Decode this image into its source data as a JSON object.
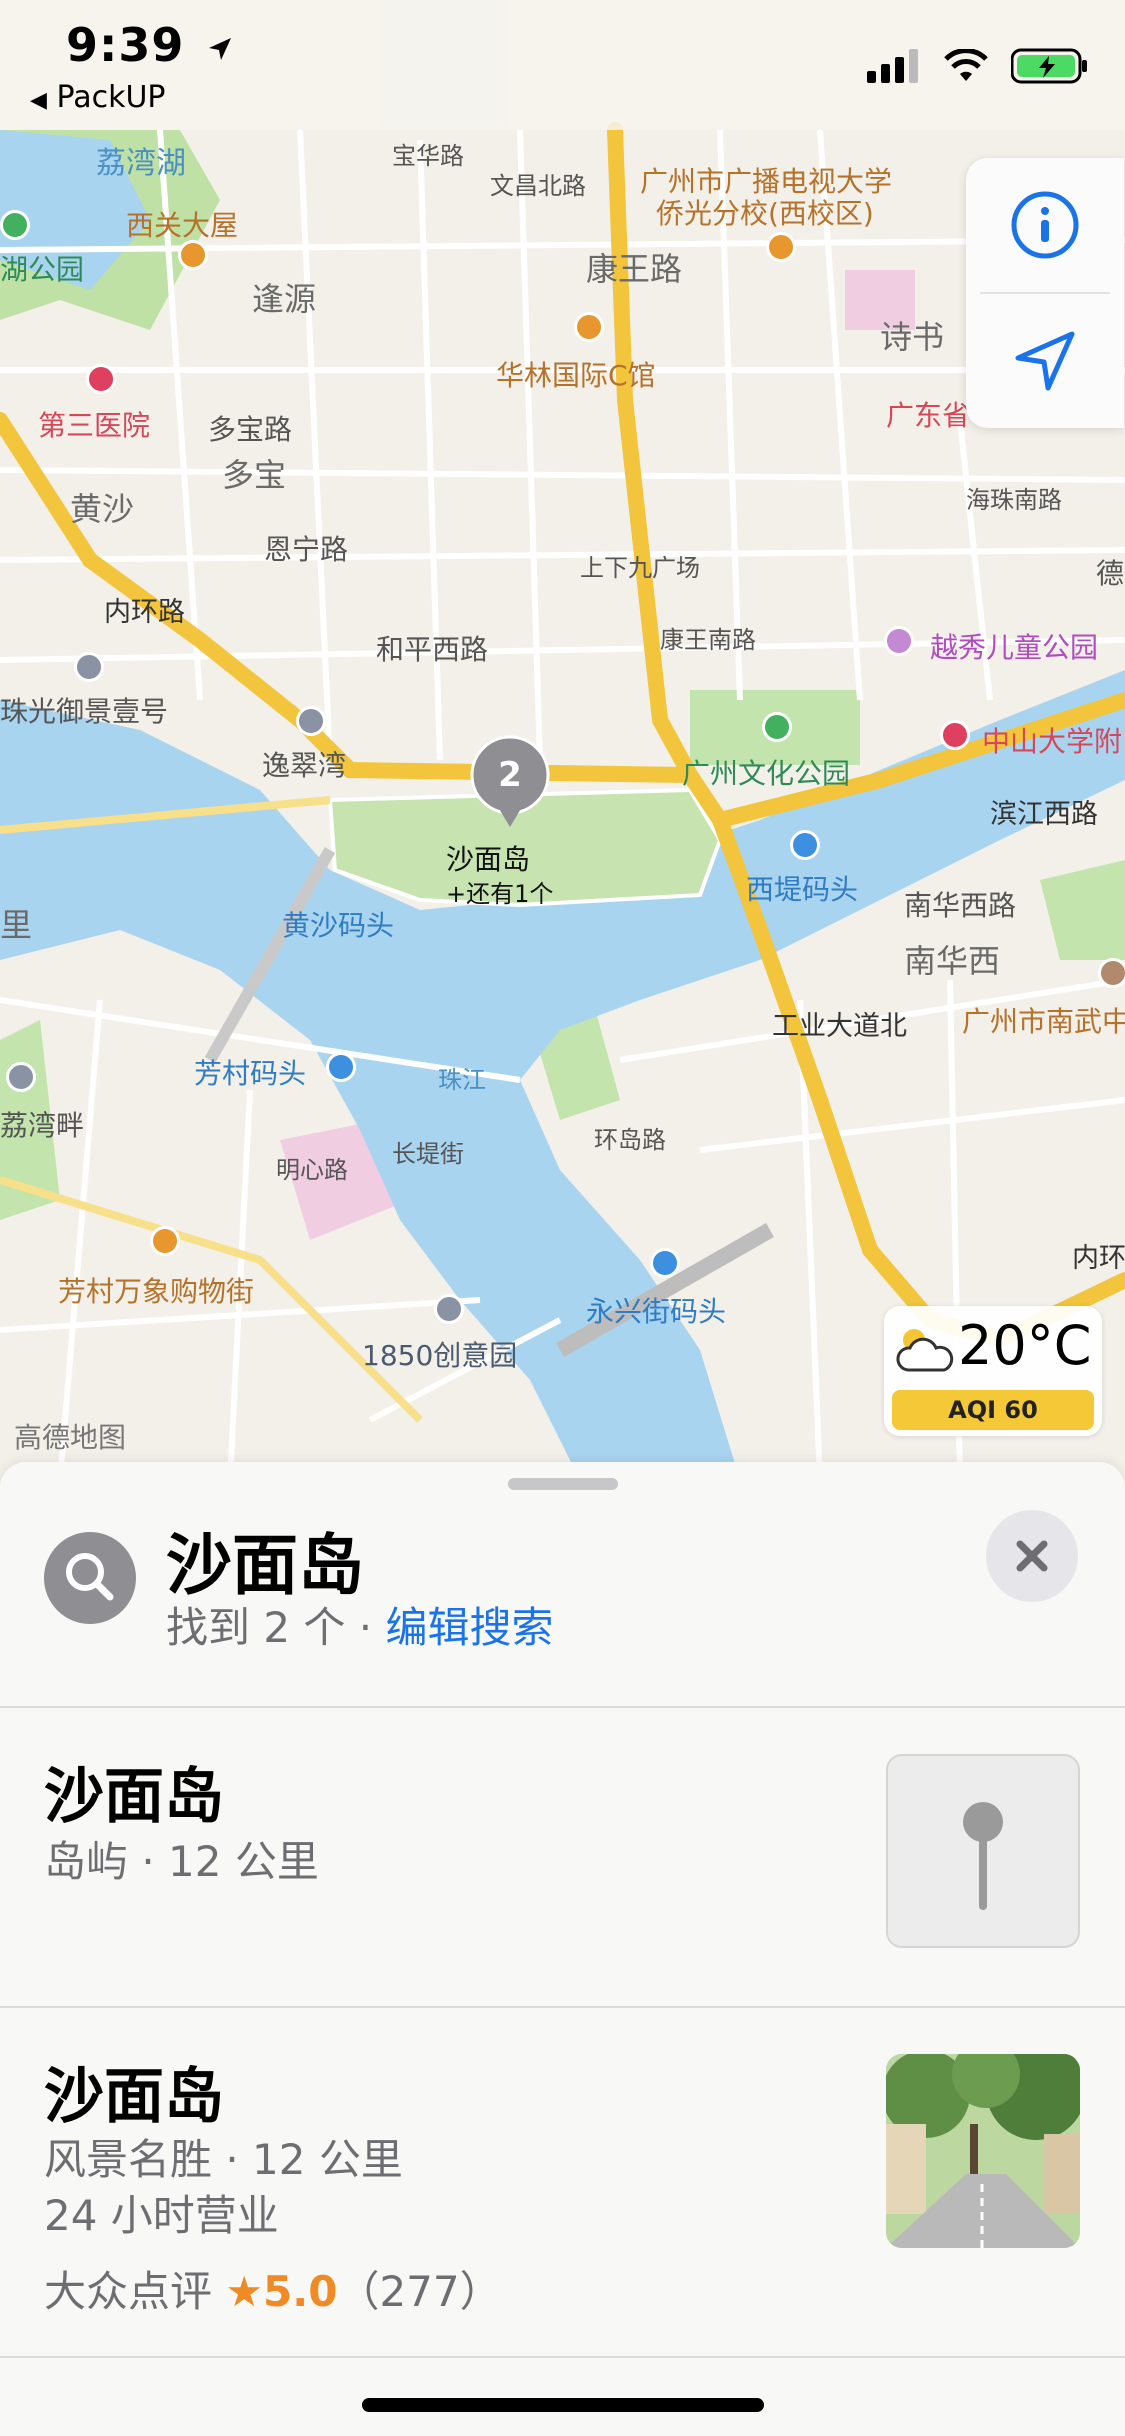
{
  "status_bar": {
    "time": "9:39",
    "back_app": "PackUP"
  },
  "map": {
    "labels": {
      "lychee_lake": "荔湾湖",
      "xiguan_mansion": "西关大屋",
      "lake_park": "湖公园",
      "fengyuan": "逢源",
      "third_hospital": "第三医院",
      "duobao_road": "多宝路",
      "duobao": "多宝",
      "huangsha": "黄沙",
      "enning_road": "恩宁路",
      "inner_ring_road": "内环路",
      "zhuguang_yujing": "珠光御景壹号",
      "yicuiwan": "逸翠湾",
      "heping_west_road": "和平西路",
      "baohua_road": "宝华路",
      "wenchang_north_road": "文昌北路",
      "tv_university": "广州市广播电视大学",
      "tv_university_2": "侨光分校(西校区)",
      "kangwang_road": "康王路",
      "hualin_mall": "华林国际C馆",
      "shishu": "诗书",
      "guangdong_province": "广东省",
      "haizhu_south_road": "海珠南路",
      "shangxiajiu": "上下九广场",
      "kangwang_south_road": "康王南路",
      "yuexiu_childrens_park": "越秀儿童公园",
      "sysu_hospital": "中山大学附",
      "culture_park": "广州文化公园",
      "binjiang_west_road": "滨江西路",
      "xiti_pier": "西堤码头",
      "nanhua_west_road": "南华西路",
      "nanhua_west": "南华西",
      "nanwu": "广州市南武中",
      "shamian_island": "沙面岛",
      "and_one_more": "+还有1个",
      "huangsha_pier": "黄沙码头",
      "li": "里",
      "fangcun_pier": "芳村码头",
      "pearl_river": "珠江",
      "lychee_bay": "荔湾畔",
      "mingxin_road": "明心路",
      "changdi_street": "长堤街",
      "huandao_road": "环岛路",
      "gongye_avenue": "工业大道北",
      "fangcun_mall": "芳村万象购物街",
      "creative_park": "1850创意园",
      "yongxing_pier": "永兴街码头",
      "gaode_map": "高德地图",
      "inner_ring_2": "内环",
      "dongyuan": "德"
    },
    "pin_count": "2"
  },
  "weather": {
    "temperature": "20°C",
    "aqi": "AQI 60"
  },
  "search": {
    "title": "沙面岛",
    "found": "找到 2 个 · ",
    "edit_link": "编辑搜索"
  },
  "results": [
    {
      "title": "沙面岛",
      "category_distance": "岛屿 · 12 公里"
    },
    {
      "title": "沙面岛",
      "category_distance": "风景名胜 · 12 公里",
      "hours": "24 小时营业",
      "rating_source": "大众点评",
      "rating_star": "★",
      "rating_value": "5.0",
      "rating_count": "（277）"
    }
  ],
  "icons": [
    "location-arrow-icon",
    "signal-icon",
    "wifi-icon",
    "battery-icon",
    "info-icon",
    "navigate-icon",
    "weather-cloud-icon",
    "search-icon",
    "close-icon",
    "map-pin-icon"
  ],
  "colors": {
    "water": "#a9d4f0",
    "road_major": "#f6d23f",
    "park": "#c6e3b0",
    "link_blue": "#1a73e8",
    "aqi_yellow": "#f5c838"
  }
}
